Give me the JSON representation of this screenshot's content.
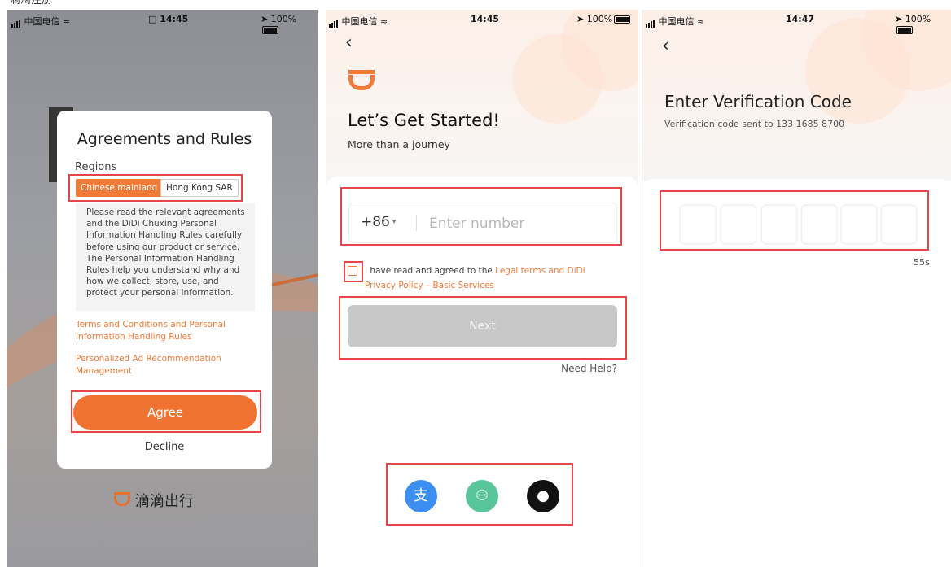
{
  "caption": "滴滴注册",
  "screen1": {
    "status": {
      "carrier": "中国电信",
      "time": "14:45",
      "battery": "100%"
    },
    "dialog": {
      "title": "Agreements and Rules",
      "regions_label": "Regions",
      "region_options": [
        "Chinese mainland",
        "Hong Kong SAR"
      ],
      "selected_region": "Chinese mainland",
      "agreement_text": "Please read the relevant agreements and the DiDi Chuxing Personal Information Handling Rules carefully before using our product or service. The Personal Information Handling Rules help you understand why and how we collect, store, use, and protect your personal information.",
      "link_terms": "Terms and Conditions and Personal Information Handling Rules",
      "link_ads": "Personalized Ad Recommendation Management",
      "agree_label": "Agree",
      "decline_label": "Decline"
    },
    "brand": "滴滴出行",
    "colors": {
      "accent": "#f07231",
      "highlight": "#e8454b"
    }
  },
  "screen2": {
    "status": {
      "carrier": "中国电信",
      "time": "14:45",
      "battery": "100%"
    },
    "back_icon": "chevron-left-icon",
    "title": "Let’s Get Started!",
    "subtitle": "More than a journey",
    "country_code": "+86",
    "phone_placeholder": "Enter number",
    "terms_prefix": "I have read and agreed to the ",
    "terms_link": "Legal terms and DiDi Privacy Policy – Basic Services",
    "next_label": "Next",
    "help_label": "Need Help?",
    "social_logins": [
      "alipay-icon",
      "wechat-icon",
      "apple-icon"
    ],
    "social_glyphs": {
      "alipay": "支",
      "wechat": "⚇",
      "apple": "●"
    }
  },
  "screen3": {
    "status": {
      "carrier": "中国电信",
      "time": "14:47",
      "battery": "100%"
    },
    "back_icon": "chevron-left-icon",
    "title": "Enter Verification Code",
    "subtitle": "Verification code sent to 133 1685 8700",
    "code_digits": 6,
    "countdown": "55s"
  }
}
